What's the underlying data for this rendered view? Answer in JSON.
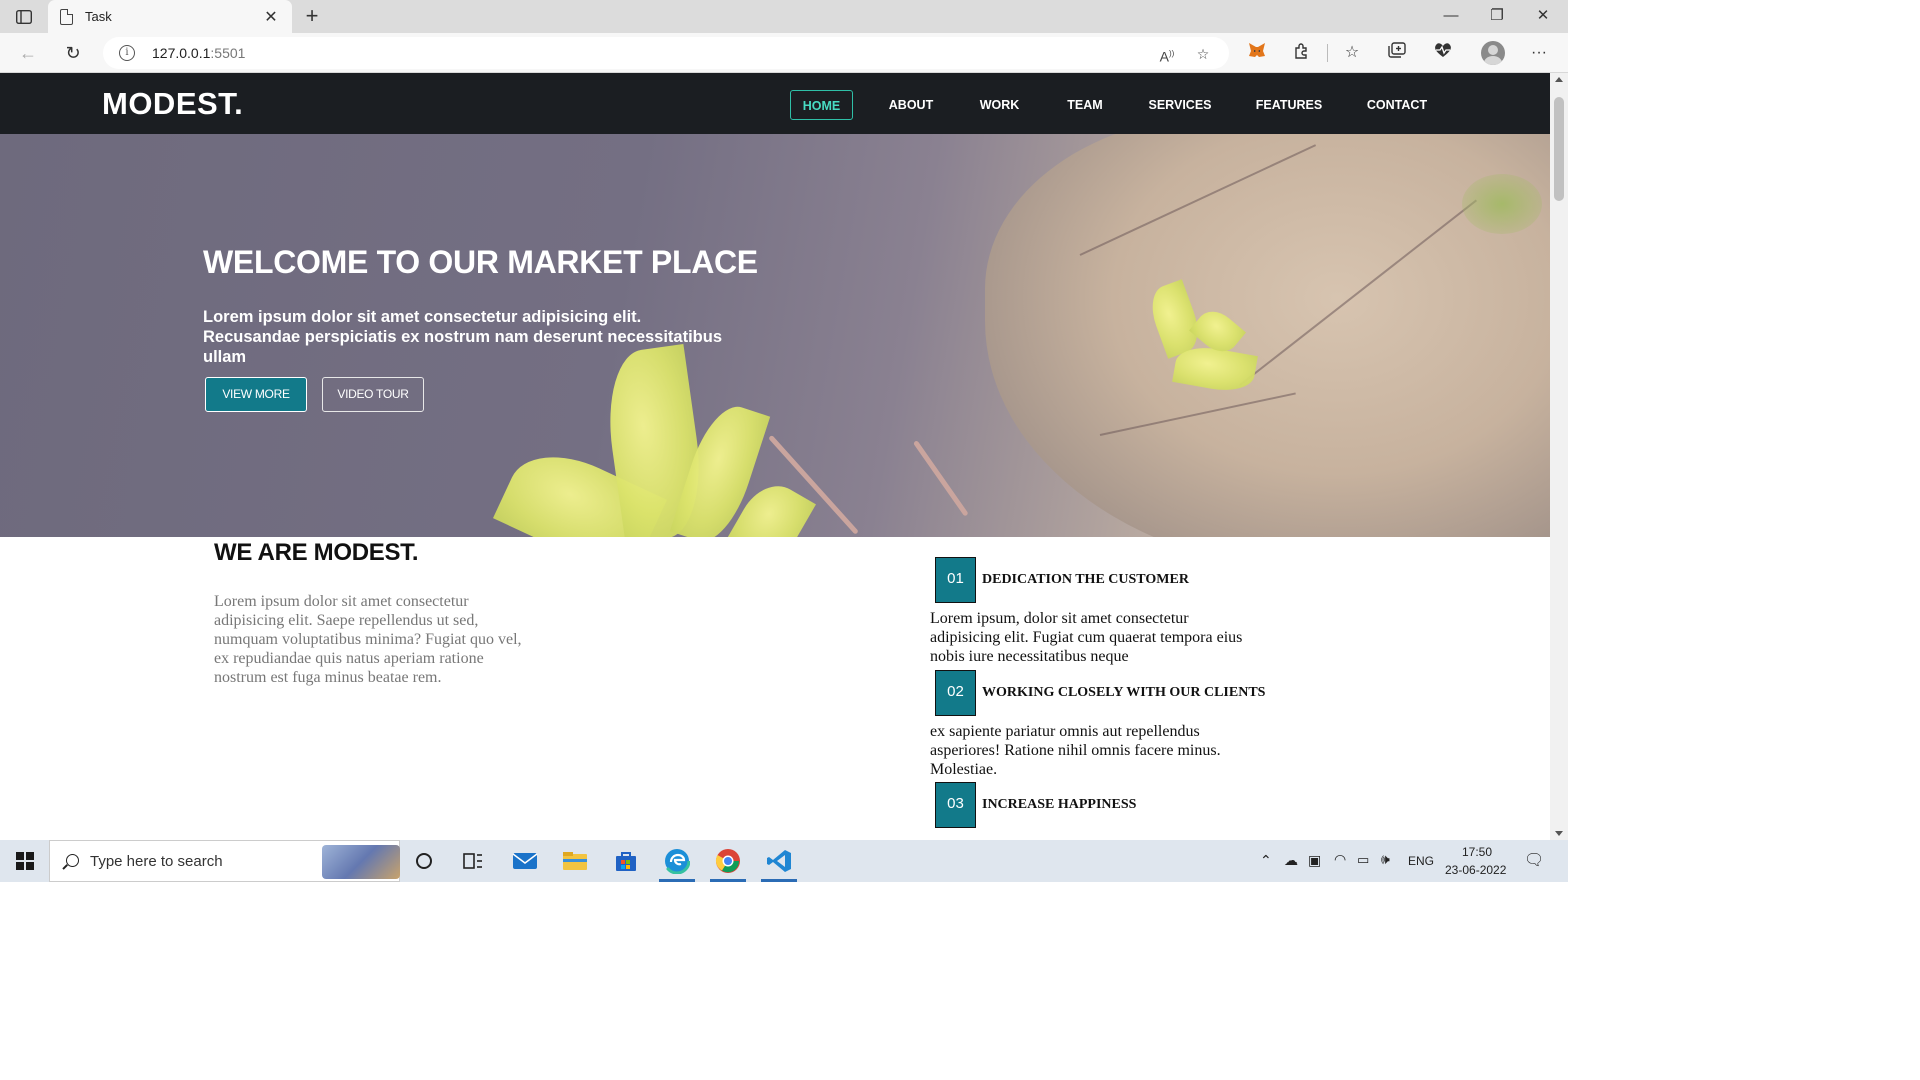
{
  "browser": {
    "tab_title": "Task",
    "url_host": "127.0.0.1",
    "url_port": ":5501"
  },
  "site": {
    "logo": "MODEST.",
    "nav": [
      "HOME",
      "ABOUT",
      "WORK",
      "TEAM",
      "SERVICES",
      "FEATURES",
      "CONTACT"
    ],
    "active_nav": "HOME",
    "hero": {
      "title": "WELCOME TO OUR MARKET PLACE",
      "subtitle": "Lorem ipsum dolor sit amet consectetur adipisicing elit. Recusandae perspiciatis ex nostrum nam deserunt necessitatibus ullam",
      "primary_button": "VIEW MORE",
      "secondary_button": "VIDEO TOUR"
    },
    "about": {
      "title": "WE ARE MODEST.",
      "text": "Lorem ipsum dolor sit amet consectetur adipisicing elit. Saepe repellendus ut sed, numquam voluptatibus minima? Fugiat quo vel, ex repudiandae quis natus aperiam ratione nostrum est fuga minus beatae rem."
    },
    "features": [
      {
        "num": "01",
        "title": "DEDICATION THE CUSTOMER",
        "text": "Lorem ipsum, dolor sit amet consectetur adipisicing elit. Fugiat cum quaerat tempora eius nobis iure necessitatibus neque"
      },
      {
        "num": "02",
        "title": "WORKING CLOSELY WITH OUR CLIENTS",
        "text": "ex sapiente pariatur omnis aut repellendus asperiores! Ratione nihil omnis facere minus. Molestiae."
      },
      {
        "num": "03",
        "title": "INCREASE HAPPINESS",
        "text": ""
      }
    ]
  },
  "taskbar": {
    "search_placeholder": "Type here to search",
    "language": "ENG",
    "time": "17:50",
    "date": "23-06-2022"
  },
  "colors": {
    "nav_bg": "#1b1e22",
    "accent": "#127a8a",
    "active_nav": "#48dcc3"
  }
}
